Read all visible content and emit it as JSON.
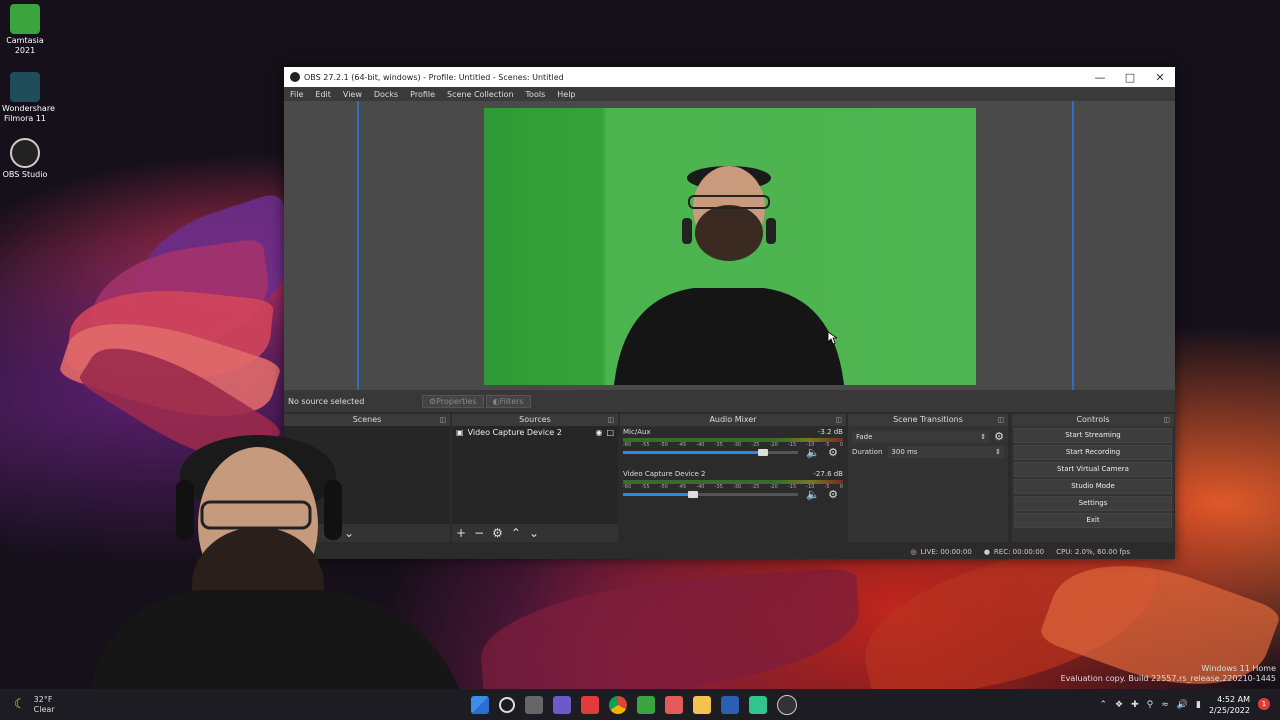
{
  "desktop": {
    "icons": [
      {
        "label": "Camtasia\n2021",
        "line1": "Camtasia",
        "line2": "2021"
      },
      {
        "line1": "Wondershare",
        "line2": "Filmora 11"
      },
      {
        "line1": "OBS Studio",
        "line2": ""
      }
    ],
    "watermark_line1": "Windows 11 Home",
    "watermark_line2": "Evaluation copy. Build 22557.rs_release.220210-1445"
  },
  "obs": {
    "title": "OBS 27.2.1 (64-bit, windows) - Profile: Untitled - Scenes: Untitled",
    "menu": [
      "File",
      "Edit",
      "View",
      "Docks",
      "Profile",
      "Scene Collection",
      "Tools",
      "Help"
    ],
    "source_bar": {
      "no_source": "No source selected",
      "properties": "Properties",
      "filters": "Filters"
    },
    "docks": {
      "scenes": "Scenes",
      "sources": "Sources",
      "audio_mixer": "Audio Mixer",
      "scene_transitions": "Scene Transitions",
      "controls": "Controls"
    },
    "sources": [
      {
        "name": "Video Capture Device 2"
      }
    ],
    "mixer": [
      {
        "name": "Mic/Aux",
        "db": "-3.2 dB",
        "level": 0.8
      },
      {
        "name": "Video Capture Device 2",
        "db": "-27.6 dB",
        "level": 0.4
      }
    ],
    "meter_scale": [
      "-60",
      "-55",
      "-50",
      "-45",
      "-40",
      "-35",
      "-30",
      "-25",
      "-20",
      "-15",
      "-10",
      "-5",
      "0"
    ],
    "transition": {
      "selected": "Fade",
      "duration_label": "Duration",
      "duration_value": "300 ms"
    },
    "controls": [
      "Start Streaming",
      "Start Recording",
      "Start Virtual Camera",
      "Studio Mode",
      "Settings",
      "Exit"
    ],
    "status": {
      "live": "LIVE: 00:00:00",
      "rec": "REC: 00:00:00",
      "cpu": "CPU: 2.0%, 60.00 fps"
    }
  },
  "taskbar": {
    "weather_temp": "32°F",
    "weather_desc": "Clear",
    "time": "4:52 AM",
    "date": "2/25/2022",
    "notification_count": "1"
  }
}
